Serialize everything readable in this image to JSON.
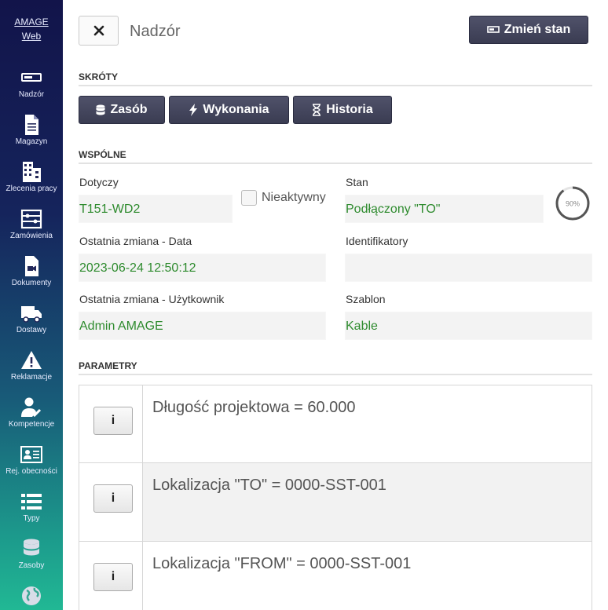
{
  "sidebar": {
    "brand_line1": "AMAGE",
    "brand_line2": "Web",
    "items": [
      {
        "label": "Nadzór",
        "icon": "monitor-icon"
      },
      {
        "label": "Magazyn",
        "icon": "document-icon"
      },
      {
        "label": "Zlecenia pracy",
        "icon": "building-icon"
      },
      {
        "label": "Zamówienia",
        "icon": "orders-icon"
      },
      {
        "label": "Dokumenty",
        "icon": "video-file-icon"
      },
      {
        "label": "Dostawy",
        "icon": "truck-icon"
      },
      {
        "label": "Reklamacje",
        "icon": "warning-icon"
      },
      {
        "label": "Kompetencje",
        "icon": "user-check-icon"
      },
      {
        "label": "Rej. obecności",
        "icon": "id-card-icon"
      },
      {
        "label": "Typy",
        "icon": "list-icon"
      },
      {
        "label": "Zasoby",
        "icon": "database-icon"
      },
      {
        "label": "",
        "icon": "globe-icon"
      }
    ]
  },
  "header": {
    "title": "Nadzór",
    "change_state_label": "Zmień stan"
  },
  "shortcuts": {
    "title": "SKRÓTY",
    "resource_label": "Zasób",
    "executions_label": "Wykonania",
    "history_label": "Historia"
  },
  "common": {
    "title": "WSPÓLNE",
    "concerns_label": "Dotyczy",
    "concerns_value": "T151-WD2",
    "inactive_label": "Nieaktywny",
    "inactive_checked": false,
    "state_label": "Stan",
    "state_value": "Podłączony \"TO\"",
    "progress_text": "90%",
    "progress_value": 0.9,
    "last_change_date_label": "Ostatnia zmiana - Data",
    "last_change_date_value": "2023-06-24 12:50:12",
    "identifiers_label": "Identifikatory",
    "identifiers_value": "",
    "last_change_user_label": "Ostatnia zmiana - Użytkownik",
    "last_change_user_value": "Admin AMAGE",
    "template_label": "Szablon",
    "template_value": "Kable"
  },
  "parameters": {
    "title": "PARAMETRY",
    "info_label": "i",
    "rows": [
      {
        "text": "Długość projektowa = 60.000"
      },
      {
        "text": "Lokalizacja \"TO\" = 0000-SST-001"
      },
      {
        "text": "Lokalizacja \"FROM\" = 0000-SST-001"
      }
    ]
  },
  "colors": {
    "sidebar_top": "#12144a",
    "sidebar_bottom": "#21b894",
    "button_dark": "#3a3c52",
    "value_green": "#2e8b2e"
  }
}
